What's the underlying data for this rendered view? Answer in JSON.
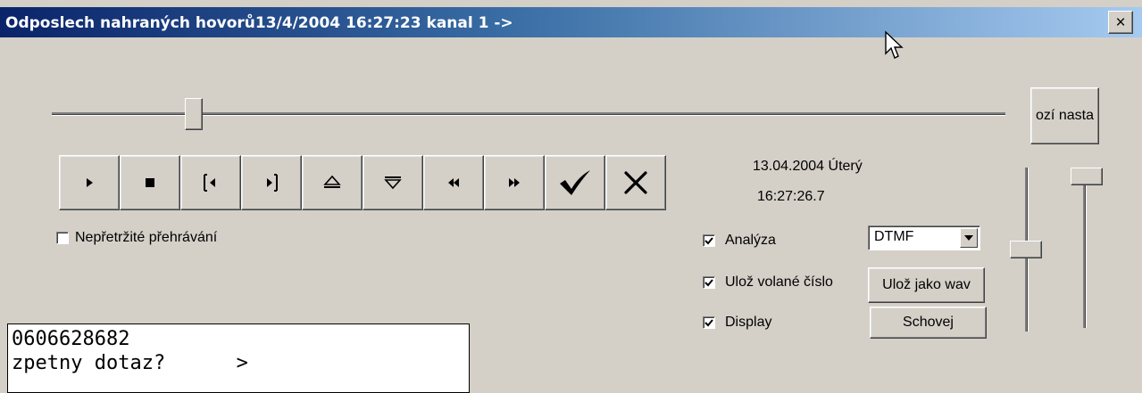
{
  "window": {
    "title": "Odposlech nahraných hovorů13/4/2004 16:27:23 kanal 1 ->",
    "close_label": "×"
  },
  "position_slider": {
    "position_fraction": 0.15
  },
  "settings_button": {
    "label": "ozí nasta"
  },
  "toolbar": {
    "buttons": [
      {
        "name": "play-button",
        "icon": "play-icon"
      },
      {
        "name": "stop-button",
        "icon": "stop-icon"
      },
      {
        "name": "previous-mark-button",
        "icon": "previous-mark-icon"
      },
      {
        "name": "next-mark-button",
        "icon": "next-mark-icon"
      },
      {
        "name": "eject-up-button",
        "icon": "eject-up-icon"
      },
      {
        "name": "eject-down-button",
        "icon": "eject-down-icon"
      },
      {
        "name": "rewind-button",
        "icon": "rewind-icon"
      },
      {
        "name": "fast-forward-button",
        "icon": "fast-forward-icon"
      },
      {
        "name": "confirm-button",
        "icon": "checkmark-icon"
      },
      {
        "name": "cancel-button",
        "icon": "cross-icon"
      }
    ]
  },
  "continuous_playback": {
    "label": "Nepřetržité přehrávání",
    "checked": false
  },
  "datetime": {
    "date": "13.04.2004 Úterý",
    "time": "16:27:26.7"
  },
  "options": {
    "analysis": {
      "label": "Analýza",
      "checked": true
    },
    "save_number": {
      "label": "Ulož volané číslo",
      "checked": true
    },
    "display": {
      "label": "Display",
      "checked": true
    }
  },
  "mode_select": {
    "value": "DTMF"
  },
  "save_wav_button": {
    "label": "Ulož jako wav"
  },
  "hide_button": {
    "label": "Schovej"
  },
  "volume_sliders": {
    "left_level": 0.42,
    "right_level": 1.0
  },
  "display_panel": {
    "line1": "0606628682",
    "line2": "zpetny dotaz?      >"
  }
}
